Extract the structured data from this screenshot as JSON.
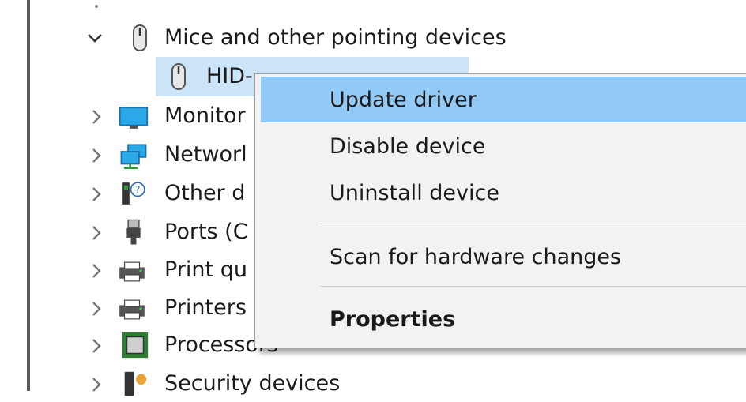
{
  "tree": {
    "items": [
      {
        "label": "Mice and other pointing devices",
        "expanded": true,
        "icon": "mouse-icon"
      },
      {
        "label": "HID-",
        "child": true,
        "icon": "mouse-icon"
      },
      {
        "label": "Monitor",
        "icon": "monitor-icon"
      },
      {
        "label": "Networl",
        "icon": "network-icon"
      },
      {
        "label": "Other d",
        "icon": "unknown-device-icon"
      },
      {
        "label": "Ports (C",
        "icon": "port-icon"
      },
      {
        "label": "Print qu",
        "icon": "print-queue-icon"
      },
      {
        "label": "Printers",
        "icon": "printer-icon"
      },
      {
        "label": "Processors",
        "icon": "processor-icon"
      },
      {
        "label": "Security devices",
        "icon": "security-device-icon"
      }
    ]
  },
  "context_menu": {
    "items": [
      {
        "label": "Update driver",
        "highlighted": true
      },
      {
        "label": "Disable device"
      },
      {
        "label": "Uninstall device"
      },
      {
        "label": "Scan for hardware changes"
      },
      {
        "label": "Properties",
        "bold": true
      }
    ]
  },
  "colors": {
    "selection": "#cce4f7",
    "menu_hover": "#91c9f7",
    "menu_bg": "#f2f2f2"
  }
}
